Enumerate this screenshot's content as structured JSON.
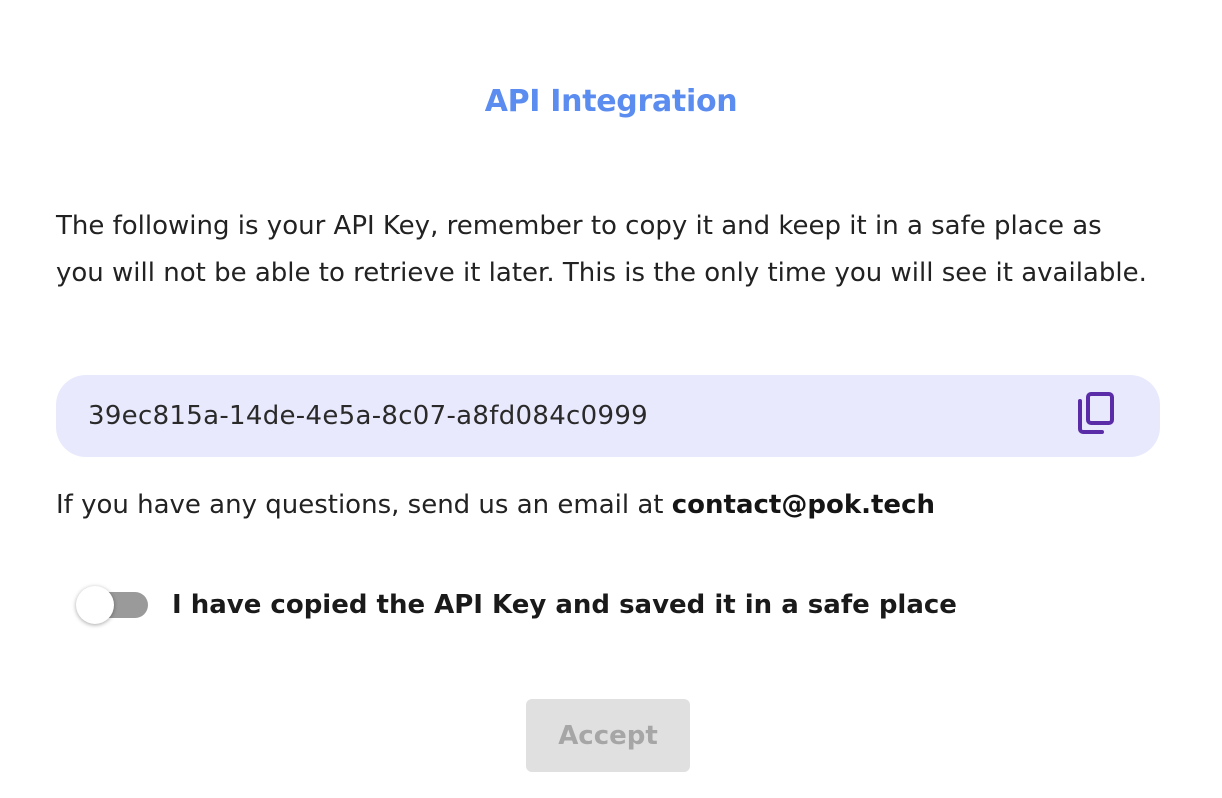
{
  "dialog": {
    "title": "API Integration",
    "description": "The following is your API Key, remember to copy it and keep it in a safe place as you will not be able to retrieve it later. This is the only time you will see it available.",
    "api_key": {
      "value": "39ec815a-14de-4e5a-8c07-a8fd084c0999",
      "copy_icon": "copy-icon"
    },
    "contact": {
      "text": "If you have any questions, send us an email at ",
      "email": "contact@pok.tech"
    },
    "confirmation": {
      "checked": false,
      "label": "I have copied the API Key and saved it in a safe place"
    },
    "accept_label": "Accept",
    "accept_enabled": false
  },
  "colors": {
    "title": "#5b8cf0",
    "key_box_bg": "#e8e9fc",
    "copy_icon": "#5a2ca8",
    "toggle_track_off": "#9a9a9a",
    "button_disabled_bg": "#e0e0e0",
    "button_disabled_text": "#a6a6a6"
  }
}
